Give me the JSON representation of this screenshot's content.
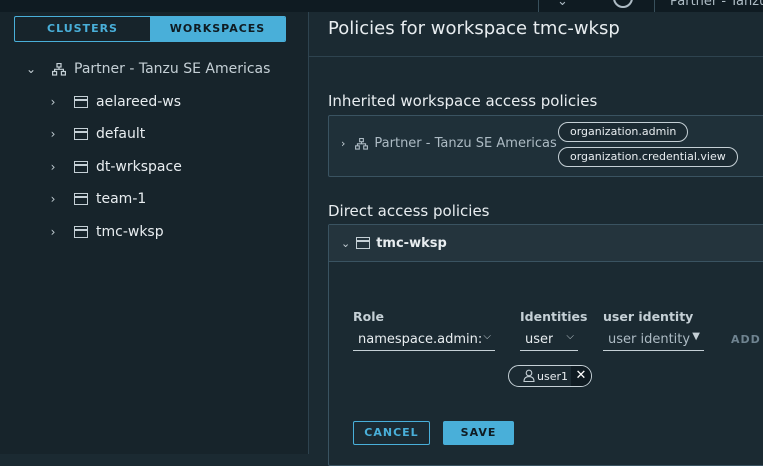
{
  "header": {
    "user_label": "Partner - Tanzu"
  },
  "tabs": {
    "clusters": "CLUSTERS",
    "workspaces": "WORKSPACES"
  },
  "tree": {
    "org": "Partner - Tanzu SE Americas",
    "workspaces": [
      "aelareed-ws",
      "default",
      "dt-wrkspace",
      "team-1",
      "tmc-wksp"
    ],
    "selected": "tmc-wksp"
  },
  "main": {
    "title": "Policies for workspace tmc-wksp",
    "inherited_heading": "Inherited workspace access policies",
    "inherited_org": "Partner - Tanzu SE Americas",
    "inherited_roles": [
      "organization.admin",
      "organization.credential.view"
    ],
    "direct_heading": "Direct access policies",
    "direct_workspace": "tmc-wksp",
    "form": {
      "role_label": "Role",
      "role_value": "namespace.admin:",
      "identities_label": "Identities",
      "identities_value": "user",
      "user_identity_label": "user identity",
      "user_identity_placeholder": "user identity",
      "add_label": "ADD"
    },
    "chip_label": "user1",
    "cancel_label": "CANCEL",
    "save_label": "SAVE"
  },
  "colors": {
    "accent": "#49afd9",
    "background": "#1b2a32",
    "sidebar": "#17242b",
    "selected": "#324f61"
  }
}
